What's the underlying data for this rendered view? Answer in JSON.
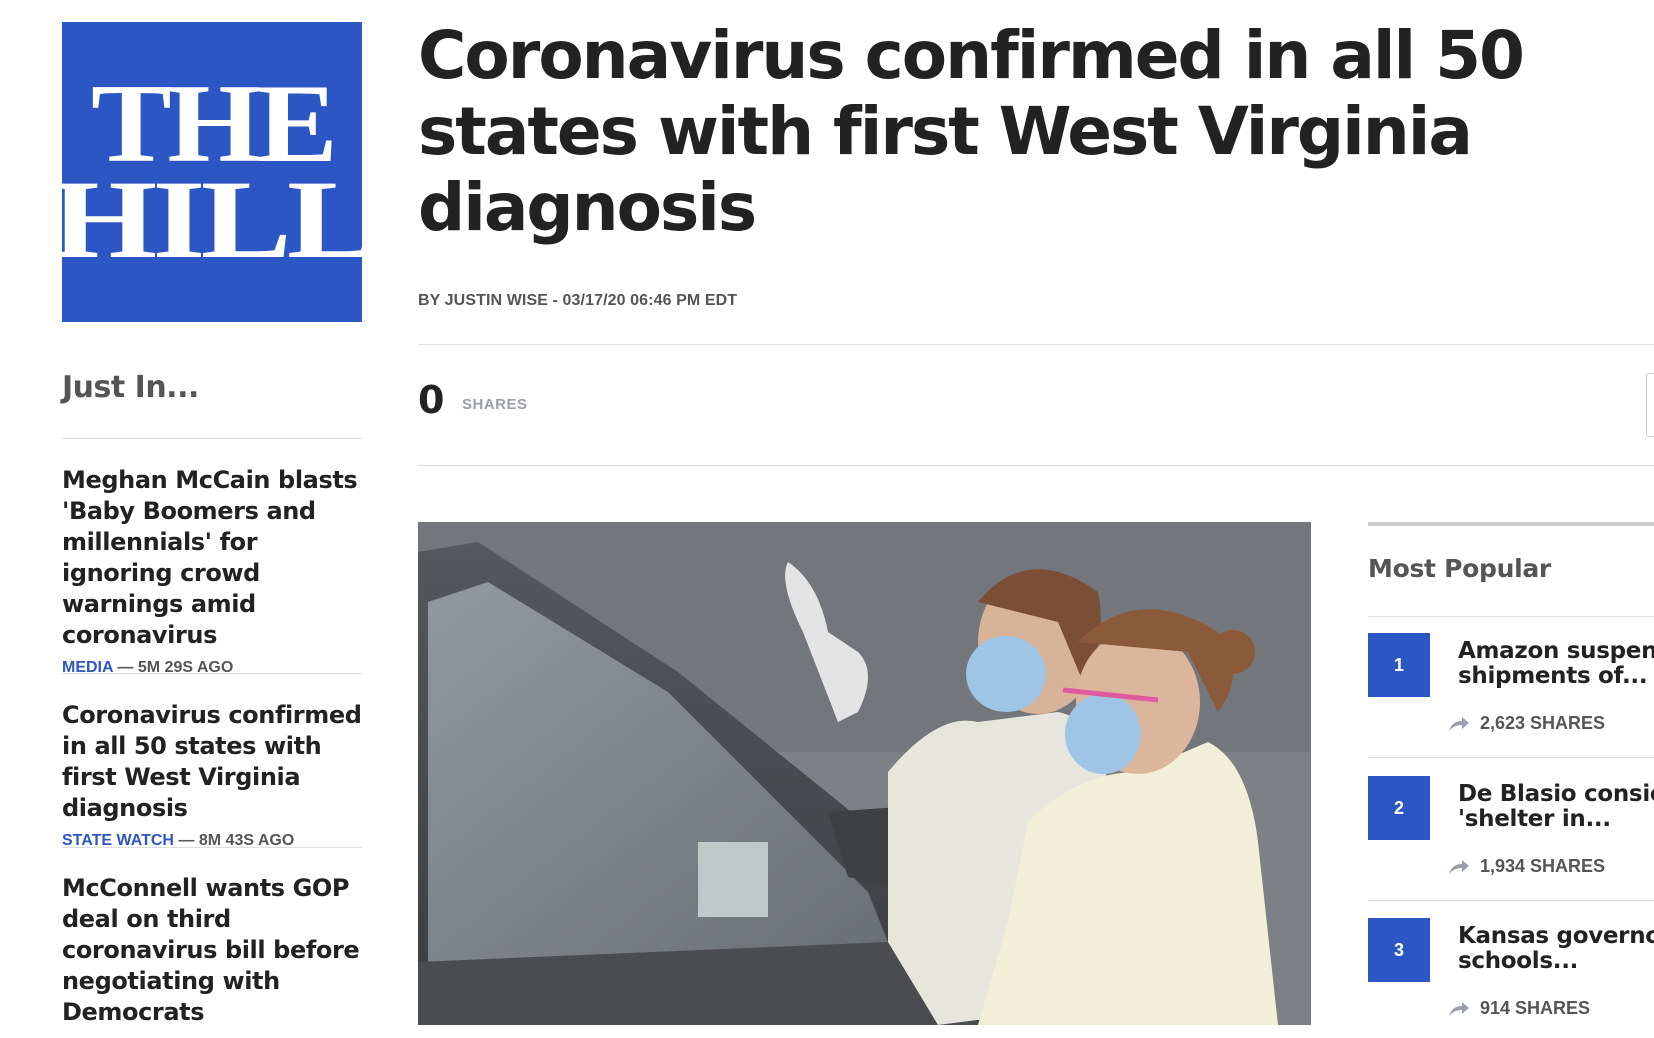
{
  "logo": {
    "line1": "THE",
    "line2": "HILL"
  },
  "article": {
    "headline": "Coronavirus confirmed in all 50 states with first West Virginia diagnosis",
    "byline": "BY JUSTIN WISE - 03/17/20 06:46 PM EDT",
    "share_count": "0",
    "share_label": "SHARES"
  },
  "just_in": {
    "heading": "Just In...",
    "stories": [
      {
        "title": "Meghan McCain blasts 'Baby Boomers and millennials' for ignoring crowd warnings amid coronavirus",
        "category": "MEDIA",
        "age": "— 5M 29S AGO"
      },
      {
        "title": "Coronavirus confirmed in all 50 states with first West Virginia diagnosis",
        "category": "STATE WATCH",
        "age": "— 8M 43S AGO"
      },
      {
        "title": "McConnell wants GOP deal on third coronavirus bill before negotiating with Democrats",
        "category": "",
        "age": ""
      }
    ]
  },
  "most_popular": {
    "heading": "Most Popular",
    "items": [
      {
        "rank": "1",
        "title_line1": "Amazon suspen",
        "title_line2": "shipments of...",
        "shares": "2,623 SHARES"
      },
      {
        "rank": "2",
        "title_line1": "De Blasio consic",
        "title_line2": "'shelter in...",
        "shares": "1,934 SHARES"
      },
      {
        "rank": "3",
        "title_line1": "Kansas governo",
        "title_line2": "schools...",
        "shares": "914 SHARES"
      }
    ]
  },
  "icons": {
    "share": "share-arrow-icon"
  },
  "colors": {
    "brand_blue": "#2c56c4",
    "text_dark": "#222222",
    "text_gray": "#555555"
  }
}
